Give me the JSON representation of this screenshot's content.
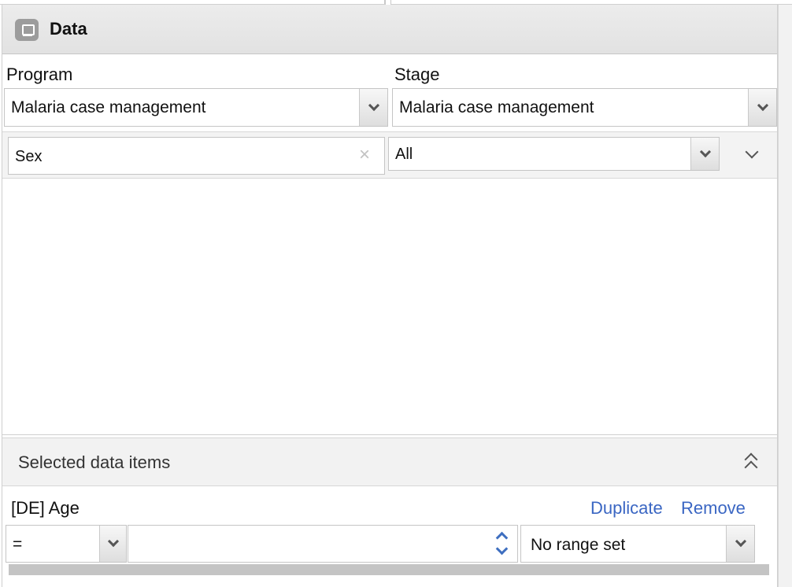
{
  "panel": {
    "title": "Data",
    "icon": "data-panel-icon"
  },
  "program": {
    "label": "Program",
    "value": "Malaria case management"
  },
  "stage": {
    "label": "Stage",
    "value": "Malaria case management"
  },
  "filter": {
    "search_value": "Sex",
    "clear_symbol": "×",
    "option_value": "All"
  },
  "selected": {
    "header": "Selected data items",
    "items": [
      {
        "name": "[DE] Age",
        "duplicate_label": "Duplicate",
        "remove_label": "Remove",
        "operator": "=",
        "value": "",
        "range": "No range set"
      }
    ]
  },
  "colors": {
    "link": "#3a66c3",
    "spinner": "#3f6fc0",
    "header_bg": "#e6e6e6"
  }
}
